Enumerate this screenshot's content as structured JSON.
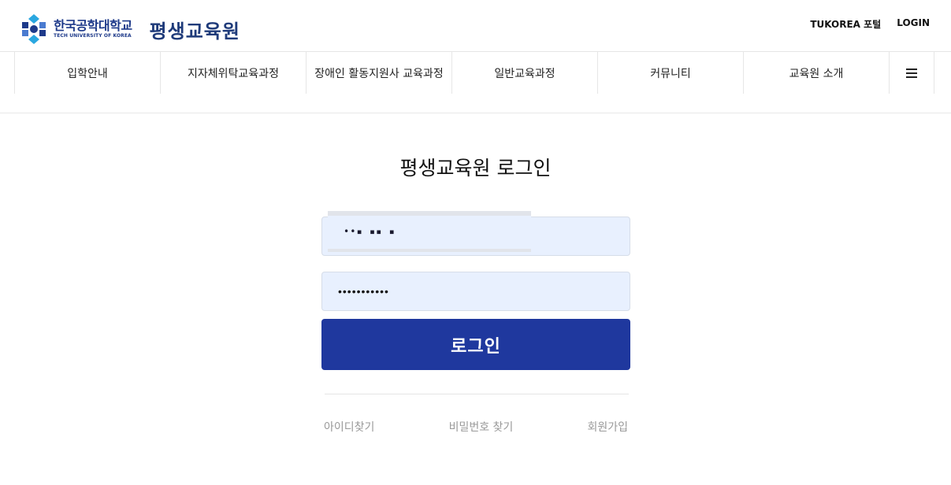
{
  "header": {
    "logo_kr": "한국공학대학교",
    "logo_en": "TECH UNIVERSITY OF KOREA",
    "logo_sub": "평생교육원",
    "util_links": [
      "TUKOREA 포털",
      "LOGIN"
    ]
  },
  "nav": {
    "items": [
      "입학안내",
      "지자체위탁교육과정",
      "장애인 활동지원사 교육과정",
      "일반교육과정",
      "커뮤니티",
      "교육원 소개"
    ],
    "menu_icon": "hamburger-icon"
  },
  "login": {
    "title": "평생교육원 로그인",
    "id_value": "••▪ ▪▪ ▪",
    "password_value": "•••••••••••",
    "button_label": "로그인",
    "links": [
      "아이디찾기",
      "비밀번호 찾기",
      "회원가입"
    ]
  },
  "colors": {
    "brand": "#1f389e",
    "field_bg": "#e8f0fe",
    "link": "#999999"
  }
}
